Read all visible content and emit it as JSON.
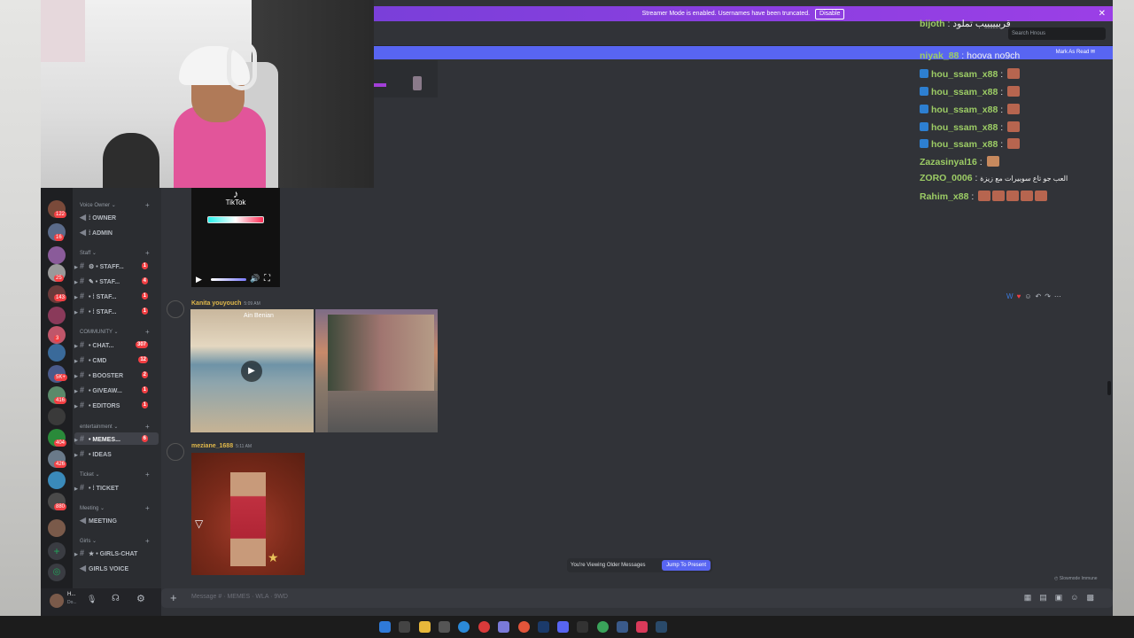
{
  "banner": {
    "text": "Streamer Mode is enabled. Usernames have been truncated.",
    "disable": "Disable"
  },
  "topbar": {
    "search_placeholder": "Search Hnous"
  },
  "mark_read": {
    "label": "Mark As Read"
  },
  "guild_badges": [
    "3",
    "122",
    "16",
    "25",
    "143",
    "3",
    "6",
    "5K+",
    "416",
    "5",
    "404",
    "426",
    "880"
  ],
  "channels": {
    "categories": [
      {
        "name": "Voice Owner",
        "items": [
          {
            "icon": "speaker",
            "label": "OWNER"
          },
          {
            "icon": "speaker",
            "label": "ADMIN"
          }
        ]
      },
      {
        "name": "Staff",
        "items": [
          {
            "label": "STAFF...",
            "badge": "1"
          },
          {
            "label": "STAF...",
            "badge": "4"
          },
          {
            "label": "STAF...",
            "badge": "1"
          },
          {
            "label": "STAF...",
            "badge": "1"
          }
        ]
      },
      {
        "name": "COMMUNITY",
        "items": [
          {
            "label": "CHAT...",
            "badge": "307"
          },
          {
            "label": "CMD",
            "badge": "12"
          },
          {
            "label": "BOOSTER",
            "badge": "2"
          },
          {
            "label": "GIVEAW...",
            "badge": "1"
          },
          {
            "label": "EDITORS",
            "badge": "1"
          }
        ]
      },
      {
        "name": "entertainment",
        "items": [
          {
            "label": "MEMES...",
            "badge": "6"
          },
          {
            "label": "IDEAS",
            "badge": ""
          }
        ]
      },
      {
        "name": "Ticket",
        "items": [
          {
            "label": "TICKET",
            "badge": ""
          }
        ]
      },
      {
        "name": "Meeting",
        "items": [
          {
            "icon": "speaker",
            "label": "MEETING"
          }
        ]
      },
      {
        "name": "Girls",
        "items": [
          {
            "label": "GIRLS-CHAT",
            "badge": ""
          },
          {
            "icon": "speaker",
            "label": "GIRLS VOICE"
          }
        ]
      }
    ]
  },
  "userbar": {
    "name": "H...",
    "status": "Do..."
  },
  "tiktok": {
    "label": "TikTok"
  },
  "messages": [
    {
      "author": "Kanita youyouch",
      "time": "5:09 AM",
      "author_color": "#e0b84a",
      "overlay": "Ain Benian"
    },
    {
      "author": "meziane_1688",
      "time": "5:11 AM",
      "author_color": "#e0b84a"
    }
  ],
  "older": {
    "text": "You're Viewing Older Messages",
    "jump": "Jump To Present"
  },
  "composer": {
    "placeholder": "Message # · MEMES · WLA · 9WD"
  },
  "slowmode": "Slowmode Immune",
  "chat_overlay": [
    {
      "name": "bijoth",
      "text": "قربيييييب تملود",
      "emotes": 0
    },
    {
      "name": "niyak_88",
      "text": "hoova no9ch",
      "emotes": 0
    },
    {
      "name": "hou_ssam_x88",
      "text": "",
      "emotes": 1,
      "box": true
    },
    {
      "name": "hou_ssam_x88",
      "text": "",
      "emotes": 1,
      "box": true
    },
    {
      "name": "hou_ssam_x88",
      "text": "",
      "emotes": 1,
      "box": true
    },
    {
      "name": "hou_ssam_x88",
      "text": "",
      "emotes": 1,
      "box": true
    },
    {
      "name": "hou_ssam_x88",
      "text": "",
      "emotes": 1,
      "box": true
    },
    {
      "name": "Zazasinyal16",
      "text": "",
      "emotes": 1
    },
    {
      "name": "ZORO_0006",
      "text": "العب جو تاع سوبيرات مع زيزة",
      "emotes": 0
    },
    {
      "name": "Rahim_x88",
      "text": "",
      "emotes": 5
    }
  ]
}
